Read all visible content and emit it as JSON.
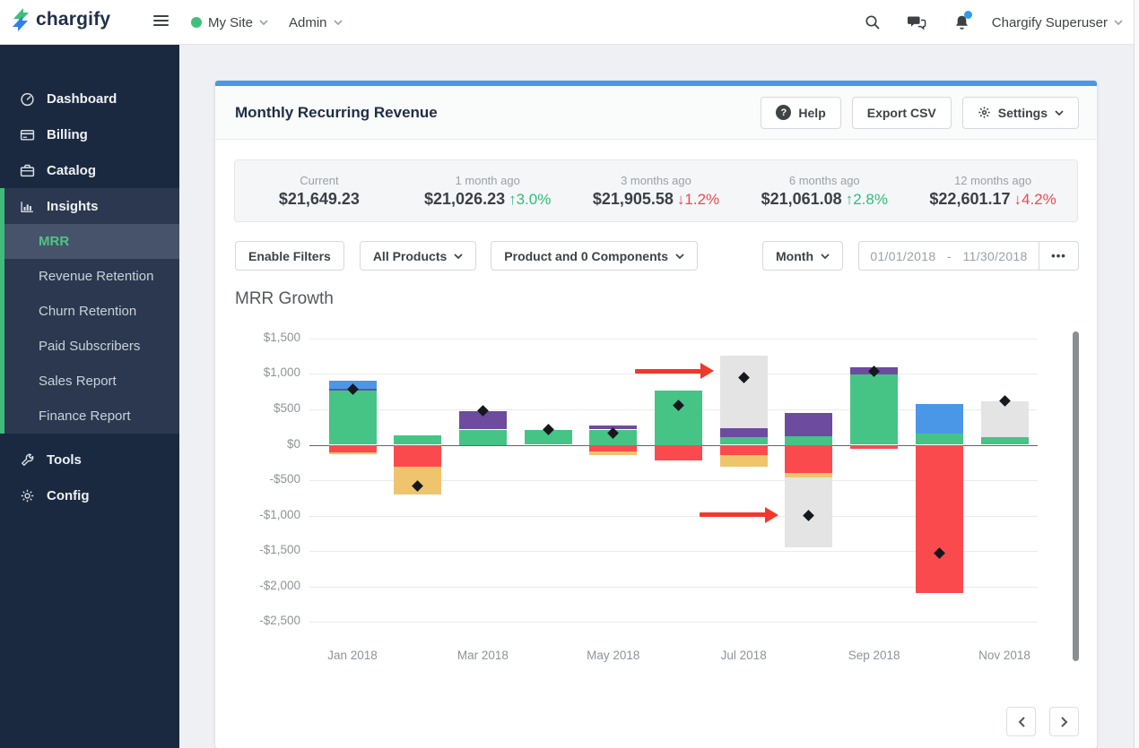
{
  "topbar": {
    "logo_text": "chargify",
    "site_menu": "My Site",
    "admin_menu": "Admin",
    "user_menu": "Chargify Superuser"
  },
  "sidebar": {
    "items": [
      {
        "label": "Dashboard",
        "icon": "gauge-icon"
      },
      {
        "label": "Billing",
        "icon": "credit-card-icon"
      },
      {
        "label": "Catalog",
        "icon": "briefcase-icon"
      },
      {
        "label": "Insights",
        "icon": "bar-chart-icon"
      }
    ],
    "insights_children": [
      {
        "label": "MRR",
        "active": true
      },
      {
        "label": "Revenue Retention"
      },
      {
        "label": "Churn Retention"
      },
      {
        "label": "Paid Subscribers"
      },
      {
        "label": "Sales Report"
      },
      {
        "label": "Finance Report"
      }
    ],
    "footer_items": [
      {
        "label": "Tools",
        "icon": "wrench-icon"
      },
      {
        "label": "Config",
        "icon": "gear-icon"
      }
    ]
  },
  "header": {
    "title": "Monthly Recurring Revenue",
    "help_label": "Help",
    "export_label": "Export CSV",
    "settings_label": "Settings"
  },
  "stats": [
    {
      "label": "Current",
      "value": "$21,649.23"
    },
    {
      "label": "1 month ago",
      "value": "$21,026.23",
      "arrow": "↑",
      "delta": "3.0%",
      "direction": "up"
    },
    {
      "label": "3 months ago",
      "value": "$21,905.58",
      "arrow": "↓",
      "delta": "1.2%",
      "direction": "down"
    },
    {
      "label": "6 months ago",
      "value": "$21,061.08",
      "arrow": "↑",
      "delta": "2.8%",
      "direction": "up"
    },
    {
      "label": "12 months ago",
      "value": "$22,601.17",
      "arrow": "↓",
      "delta": "4.2%",
      "direction": "down"
    }
  ],
  "filters": {
    "enable_filters": "Enable Filters",
    "products": "All Products",
    "components": "Product and 0 Components",
    "interval": "Month",
    "date_start": "01/01/2018",
    "date_separator": "-",
    "date_end": "11/30/2018",
    "more": "•••"
  },
  "chart_data": {
    "type": "bar",
    "stacked": true,
    "title": "MRR Growth",
    "ylabel": "",
    "xlabel": "",
    "ylim": [
      -2500,
      1500
    ],
    "grid": true,
    "ytick_values": [
      1500,
      1000,
      500,
      0,
      -500,
      -1000,
      -1500,
      -2000,
      -2500
    ],
    "ytick_labels": [
      "$1,500",
      "$1,000",
      "$500",
      "$0",
      "-$500",
      "-$1,000",
      "-$1,500",
      "-$2,000",
      "-$2,500"
    ],
    "x_axis_labels": [
      "Jan 2018",
      "Mar 2018",
      "May 2018",
      "Jul 2018",
      "Sep 2018",
      "Nov 2018"
    ],
    "colors": {
      "green": "#45c486",
      "purple": "#6d4b9f",
      "blue": "#4a97e8",
      "red": "#fb4a4d",
      "yellow": "#eec56c",
      "gray": "#e4e4e5",
      "marker": "#15181c",
      "arrow": "#f0392b"
    },
    "bars": [
      {
        "month": "Jan 2018",
        "positive": [
          [
            "green",
            770
          ],
          [
            "purple",
            25
          ],
          [
            "blue",
            105
          ]
        ],
        "negative": [
          [
            "red",
            110
          ],
          [
            "yellow",
            20
          ]
        ],
        "marker": 780
      },
      {
        "month": "Feb 2018",
        "positive": [
          [
            "green",
            130
          ]
        ],
        "negative": [
          [
            "red",
            310
          ],
          [
            "yellow",
            390
          ]
        ],
        "marker": -575
      },
      {
        "month": "Mar 2018",
        "positive": [
          [
            "green",
            215
          ],
          [
            "purple",
            260
          ]
        ],
        "negative": [],
        "marker": 480
      },
      {
        "month": "Apr 2018",
        "positive": [
          [
            "green",
            205
          ]
        ],
        "negative": [],
        "marker": 210
      },
      {
        "month": "May 2018",
        "positive": [
          [
            "green",
            215
          ],
          [
            "purple",
            55
          ]
        ],
        "negative": [
          [
            "red",
            90
          ],
          [
            "yellow",
            50
          ]
        ],
        "marker": 170
      },
      {
        "month": "Jun 2018",
        "positive": [
          [
            "green",
            765
          ]
        ],
        "negative": [
          [
            "red",
            215
          ]
        ],
        "marker": 560
      },
      {
        "month": "Jul 2018",
        "positive": [
          [
            "green",
            105
          ],
          [
            "purple",
            130
          ],
          [
            "gray",
            1020
          ]
        ],
        "negative": [
          [
            "red",
            145
          ],
          [
            "yellow",
            165
          ]
        ],
        "marker": 950
      },
      {
        "month": "Aug 2018",
        "positive": [
          [
            "green",
            120
          ],
          [
            "purple",
            335
          ]
        ],
        "negative": [
          [
            "red",
            400
          ],
          [
            "yellow",
            60
          ],
          [
            "gray",
            990
          ]
        ],
        "marker": -1000
      },
      {
        "month": "Sep 2018",
        "positive": [
          [
            "green",
            990
          ],
          [
            "purple",
            105
          ]
        ],
        "negative": [
          [
            "red",
            55
          ]
        ],
        "marker": 1040
      },
      {
        "month": "Oct 2018",
        "positive": [
          [
            "green",
            160
          ],
          [
            "blue",
            410
          ]
        ],
        "negative": [
          [
            "red",
            2090
          ]
        ],
        "marker": -1530
      },
      {
        "month": "Nov 2018",
        "positive": [
          [
            "green",
            105
          ],
          [
            "gray",
            510
          ]
        ],
        "negative": [],
        "marker": 615
      }
    ],
    "arrows": [
      {
        "month": "Jul 2018",
        "value": 1040
      },
      {
        "month": "Aug 2018",
        "value": -990
      }
    ]
  },
  "pagination": {
    "prev_icon": "chevron-left-icon",
    "next_icon": "chevron-right-icon"
  }
}
